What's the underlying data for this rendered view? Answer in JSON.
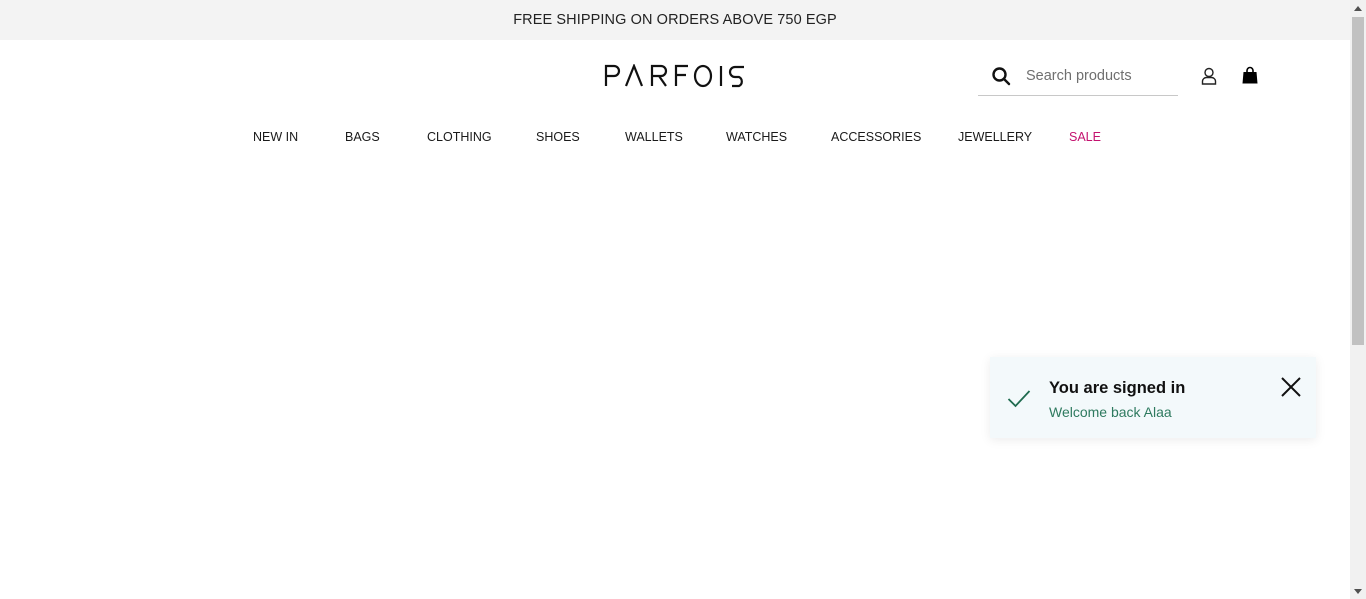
{
  "promo": {
    "text": "FREE SHIPPING ON ORDERS ABOVE 750 EGP"
  },
  "header": {
    "logo_text": "PARFOIS",
    "search": {
      "placeholder": "Search products",
      "value": ""
    },
    "icons": {
      "search": "search-icon",
      "account": "user-icon",
      "bag": "shopping-bag-icon"
    }
  },
  "nav": {
    "items": [
      {
        "label": "NEW IN"
      },
      {
        "label": "BAGS"
      },
      {
        "label": "CLOTHING"
      },
      {
        "label": "SHOES"
      },
      {
        "label": "WALLETS"
      },
      {
        "label": "WATCHES"
      },
      {
        "label": "ACCESSORIES"
      },
      {
        "label": "JEWELLERY"
      },
      {
        "label": "SALE"
      }
    ]
  },
  "toast": {
    "title": "You are signed in",
    "message": "Welcome back Alaa",
    "icons": {
      "status": "checkmark-icon",
      "close": "close-icon"
    }
  },
  "colors": {
    "sale": "#c4126f",
    "toast_background": "#f3f9fb",
    "toast_message": "#2e7a5f",
    "checkmark": "#1f6b4f",
    "promo_background": "#f3f3f3"
  }
}
